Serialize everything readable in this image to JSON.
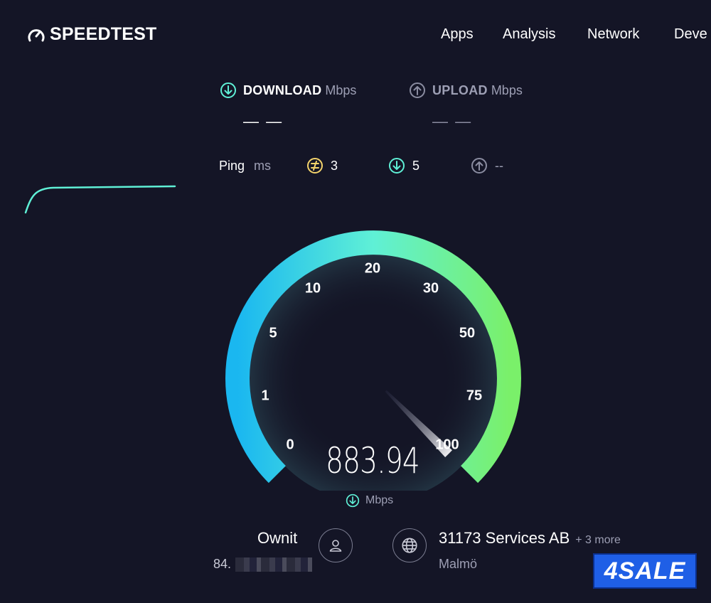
{
  "header": {
    "brand": "SPEEDTEST",
    "nav": [
      "Apps",
      "Analysis",
      "Network",
      "Deve"
    ]
  },
  "download": {
    "label": "DOWNLOAD",
    "unit": "Mbps",
    "value": "— —"
  },
  "upload": {
    "label": "UPLOAD",
    "unit": "Mbps",
    "value": "— —"
  },
  "ping": {
    "label": "Ping",
    "unit": "ms",
    "idle": "3",
    "download": "5",
    "upload": "--"
  },
  "gauge": {
    "ticks": [
      "0",
      "1",
      "5",
      "10",
      "20",
      "30",
      "50",
      "75",
      "100"
    ],
    "speed": "883.94",
    "unit": "Mbps",
    "needle_value": 100,
    "colors": {
      "start": "#1ab7f0",
      "mid": "#5ff0d6",
      "end": "#7af06a"
    }
  },
  "client": {
    "isp": "Ownit",
    "ip": "84."
  },
  "server": {
    "name": "31173 Services AB",
    "more": "+ 3 more",
    "city": "Malmö"
  },
  "badge": {
    "text": "4SALE"
  },
  "colors": {
    "background": "#141526",
    "accent": "#5ff0d6",
    "ping_idle": "#f4d36b",
    "muted": "#9d9fb4"
  }
}
